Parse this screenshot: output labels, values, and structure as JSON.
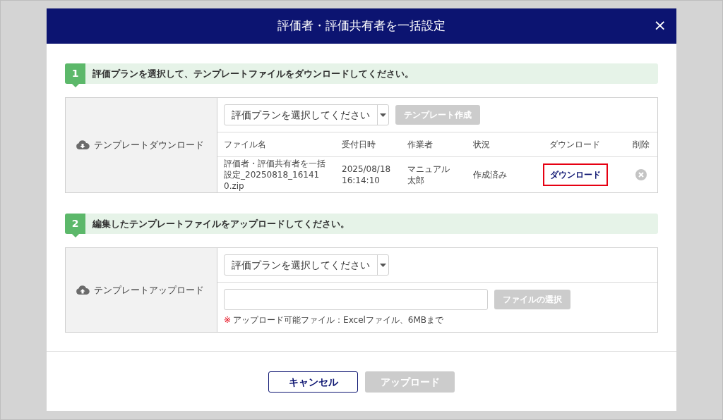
{
  "dialog": {
    "title": "評価者・評価共有者を一括設定",
    "close": "×"
  },
  "sections": [
    {
      "number": "1",
      "heading": "評価プランを選択して、テンプレートファイルをダウンロードしてください。",
      "label": "テンプレートダウンロード",
      "kind": "download",
      "select": {
        "value": "評価プランを選択してください"
      },
      "action": {
        "label": "テンプレート作成",
        "disabled": true
      },
      "table": {
        "columns": [
          "ファイル名",
          "受付日時",
          "作業者",
          "状況",
          "ダウンロード",
          "削除"
        ],
        "rows": [
          {
            "file": "評価者・評価共有者を一括設定_20250818_161410.zip",
            "date": "2025/08/18 16:14:10",
            "worker": "マニュアル太郎",
            "status": "作成済み",
            "download": "ダウンロード",
            "highlighted": true
          }
        ]
      }
    },
    {
      "number": "2",
      "heading": "編集したテンプレートファイルをアップロードしてください。",
      "label": "テンプレートアップロード",
      "kind": "upload",
      "select": {
        "value": "評価プランを選択してください"
      },
      "action": {
        "label": "ファイルの選択",
        "disabled": true
      },
      "note_mark": "※",
      "note": "アップロード可能ファイル：Excelファイル、6MBまで"
    }
  ],
  "buttons": [
    {
      "label": "キャンセル",
      "disabled": false
    },
    {
      "label": "アップロード",
      "disabled": true
    }
  ]
}
